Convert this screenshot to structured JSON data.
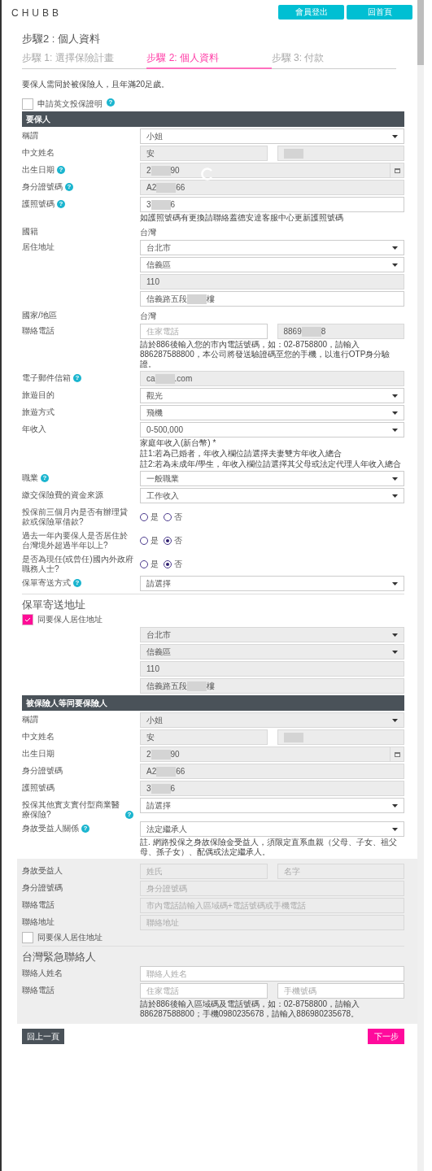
{
  "header": {
    "logo": "CHUBB",
    "buttons": [
      "會員登出",
      "回首頁"
    ]
  },
  "page_title": "步驟2 : 個人資料",
  "steps": [
    {
      "label": "步驟 1: 選擇保險計畫",
      "selected": false
    },
    {
      "label": "步驟 2: 個人資料",
      "selected": true
    },
    {
      "label": "步驟 3: 付款",
      "selected": false
    }
  ],
  "intro": "要保人需同於被保險人，且年滿20足歲。",
  "form": {
    "rows": [
      {
        "kind": "checkbox",
        "label": "申請英文投保證明",
        "checked": false,
        "help": "?"
      },
      {
        "kind": "bar",
        "title": "要保人"
      },
      {
        "kind": "field",
        "label": "稱謂",
        "inputs": [
          {
            "kind": "select",
            "value": "小姐",
            "disabled": false
          }
        ]
      },
      {
        "kind": "field",
        "label": "中文姓名",
        "inputs": [
          {
            "kind": "text",
            "value": "安",
            "disabled": true
          },
          {
            "kind": "text",
            "redacted": true,
            "disabled": true
          }
        ]
      },
      {
        "kind": "field",
        "label": "出生日期",
        "help": "?",
        "inputs": [
          {
            "kind": "date",
            "value": "2",
            "redacted": true,
            "value_end": "90",
            "disabled": true
          }
        ]
      },
      {
        "kind": "field",
        "label": "身分證號碼",
        "help": "?",
        "inputs": [
          {
            "kind": "text",
            "value": "A2",
            "redacted": true,
            "value_end": "66",
            "disabled": true
          }
        ]
      },
      {
        "kind": "field",
        "label": "護照號碼",
        "help": "?",
        "inputs": [
          {
            "kind": "text",
            "value": "3",
            "redacted": true,
            "value_end": "6",
            "disabled": false
          }
        ],
        "notes": [
          "如護照號碼有更換請聯絡蓋德安達客服中心更新護照號碼"
        ]
      },
      {
        "kind": "text",
        "label": "國籍",
        "value": "台灣"
      },
      {
        "kind": "field",
        "label": "居住地址",
        "inputs": [
          {
            "kind": "select",
            "value": "台北市",
            "disabled": false
          }
        ]
      },
      {
        "kind": "field",
        "inputs": [
          {
            "kind": "select",
            "value": "信義區",
            "disabled": false
          }
        ]
      },
      {
        "kind": "field",
        "inputs": [
          {
            "kind": "text",
            "value": "110",
            "disabled": true
          }
        ]
      },
      {
        "kind": "field",
        "inputs": [
          {
            "kind": "text",
            "value": "信義路五段",
            "redacted": true,
            "value_end": "樓",
            "disabled": false
          }
        ]
      },
      {
        "kind": "text",
        "label": "國家/地區",
        "value": "台灣"
      },
      {
        "kind": "field",
        "label": "聯絡電話",
        "inputs": [
          {
            "kind": "text",
            "placeholder": "住家電話",
            "disabled": false
          },
          {
            "kind": "text",
            "value": "8869",
            "redacted": true,
            "value_end": "8",
            "disabled": true
          }
        ],
        "notes": [
          "請於886後輸入您的市內電話號碼，如：02-8758800，請輸入886287588800，本公司將發送驗證碼至您的手機，以進行OTP身分驗證。"
        ]
      },
      {
        "kind": "field",
        "label": "電子郵件信箱",
        "help": "?",
        "inputs": [
          {
            "kind": "text",
            "value": "ca",
            "redacted": true,
            "value_end": ".com",
            "disabled": true
          }
        ]
      },
      {
        "kind": "field",
        "label": "旅遊目的",
        "inputs": [
          {
            "kind": "select",
            "value": "觀光",
            "disabled": false
          }
        ]
      },
      {
        "kind": "field",
        "label": "旅遊方式",
        "inputs": [
          {
            "kind": "select",
            "value": "飛機",
            "disabled": false
          }
        ]
      },
      {
        "kind": "field",
        "label": "年收入",
        "inputs": [
          {
            "kind": "select",
            "value": "0-500,000",
            "disabled": false
          }
        ],
        "notes": [
          "家庭年收入(新台幣) *",
          "註1:若為已婚者，年收入欄位請選擇夫妻雙方年收入總合",
          "註2:若為未成年/學生，年收入欄位請選擇其父母或法定代理人年收入總合"
        ]
      },
      {
        "kind": "field",
        "label": "職業",
        "help": "?",
        "inputs": [
          {
            "kind": "select",
            "value": "一般職業",
            "disabled": false
          }
        ]
      },
      {
        "kind": "field",
        "label": "繳交保險費的資金來源",
        "inputs": [
          {
            "kind": "select",
            "value": "工作收入",
            "disabled": false
          }
        ]
      },
      {
        "kind": "radio",
        "label": "投保前三個月內是否有辦理貸款或保險單借款?",
        "options": [
          {
            "label": "是",
            "selected": false
          },
          {
            "label": "否",
            "selected": false
          }
        ]
      },
      {
        "kind": "radio",
        "label": "過去一年內要保人是否居住於台灣境外超過半年以上?",
        "options": [
          {
            "label": "是",
            "selected": false
          },
          {
            "label": "否",
            "selected": true
          }
        ]
      },
      {
        "kind": "radio",
        "label": "是否為現任(或曾任)國內外政府職務人士?",
        "options": [
          {
            "label": "是",
            "selected": false
          },
          {
            "label": "否",
            "selected": true
          }
        ]
      },
      {
        "kind": "field",
        "label": "保單寄送方式",
        "help": "?",
        "inputs": [
          {
            "kind": "select",
            "value": "請選擇",
            "disabled": false
          }
        ]
      },
      {
        "kind": "divider"
      },
      {
        "kind": "heading",
        "title": "保單寄送地址"
      },
      {
        "kind": "checkbox",
        "label": "同要保人居住地址",
        "checked": true
      },
      {
        "kind": "field",
        "inputs": [
          {
            "kind": "select",
            "value": "台北市",
            "disabled": true
          }
        ]
      },
      {
        "kind": "field",
        "inputs": [
          {
            "kind": "select",
            "value": "信義區",
            "disabled": true
          }
        ]
      },
      {
        "kind": "field",
        "inputs": [
          {
            "kind": "text",
            "value": "110",
            "disabled": true
          }
        ]
      },
      {
        "kind": "field",
        "inputs": [
          {
            "kind": "text",
            "value": "信義路五段",
            "redacted": true,
            "value_end": "樓",
            "disabled": true
          }
        ]
      },
      {
        "kind": "bar",
        "title": "被保險人等同要保險人"
      },
      {
        "kind": "field",
        "label": "稱謂",
        "inputs": [
          {
            "kind": "select",
            "value": "小姐",
            "disabled": true
          }
        ]
      },
      {
        "kind": "field",
        "label": "中文姓名",
        "inputs": [
          {
            "kind": "text",
            "value": "安",
            "disabled": true
          },
          {
            "kind": "text",
            "redacted": true,
            "disabled": true
          }
        ]
      },
      {
        "kind": "field",
        "label": "出生日期",
        "inputs": [
          {
            "kind": "date",
            "value": "2",
            "redacted": true,
            "value_end": "90",
            "disabled": true
          }
        ]
      },
      {
        "kind": "field",
        "label": "身分證號碼",
        "inputs": [
          {
            "kind": "text",
            "value": "A2",
            "redacted": true,
            "value_end": "66",
            "disabled": true
          }
        ]
      },
      {
        "kind": "field",
        "label": "護照號碼",
        "inputs": [
          {
            "kind": "text",
            "value": "3",
            "redacted": true,
            "value_end": "6",
            "disabled": true
          }
        ]
      },
      {
        "kind": "field",
        "label": "投保其他實支實付型商業醫療保險?",
        "help": "?",
        "inputs": [
          {
            "kind": "select",
            "value": "請選擇",
            "disabled": false
          }
        ]
      },
      {
        "kind": "field",
        "label": "身故受益人關係",
        "help": "?",
        "inputs": [
          {
            "kind": "select",
            "value": "法定繼承人",
            "disabled": false
          }
        ],
        "notes": [
          "註. 網路投保之身故保險金受益人，須限定直系血親（父母、子女、祖父母、孫子女）、配偶或法定繼承人。"
        ]
      }
    ]
  },
  "beneficiary_panel": {
    "rows": [
      {
        "kind": "field",
        "label": "身故受益人",
        "inputs": [
          {
            "kind": "text",
            "placeholder": "姓氏",
            "disabled": true
          },
          {
            "kind": "text",
            "placeholder": "名字",
            "disabled": true
          }
        ]
      },
      {
        "kind": "field",
        "label": "身分證號碼",
        "inputs": [
          {
            "kind": "text",
            "placeholder": "身分證號碼",
            "disabled": true
          }
        ]
      },
      {
        "kind": "field",
        "label": "聯絡電話",
        "inputs": [
          {
            "kind": "text",
            "placeholder": "市內電話請輸入區域碼+電話號碼或手機電話",
            "disabled": true
          }
        ]
      },
      {
        "kind": "field",
        "label": "聯絡地址",
        "inputs": [
          {
            "kind": "text",
            "placeholder": "聯絡地址",
            "disabled": true
          }
        ]
      },
      {
        "kind": "checkbox",
        "label": "同要保人居住地址",
        "checked": false
      },
      {
        "kind": "divider"
      },
      {
        "kind": "heading",
        "title": "台灣緊急聯絡人"
      },
      {
        "kind": "field",
        "label": "聯絡人姓名",
        "inputs": [
          {
            "kind": "text",
            "placeholder": "聯絡人姓名",
            "disabled": false
          }
        ]
      },
      {
        "kind": "field",
        "label": "聯絡電話",
        "inputs": [
          {
            "kind": "text",
            "placeholder": "住家電話",
            "disabled": false
          },
          {
            "kind": "text",
            "placeholder": "手機號碼",
            "disabled": false
          }
        ],
        "notes": [
          "請於886後輸入區域碼及電話號碼，如：02-8758800，請輸入886287588800；手機0980235678，請輸入886980235678。"
        ]
      }
    ]
  },
  "actions": {
    "back": "回上一頁",
    "next": "下一步"
  }
}
